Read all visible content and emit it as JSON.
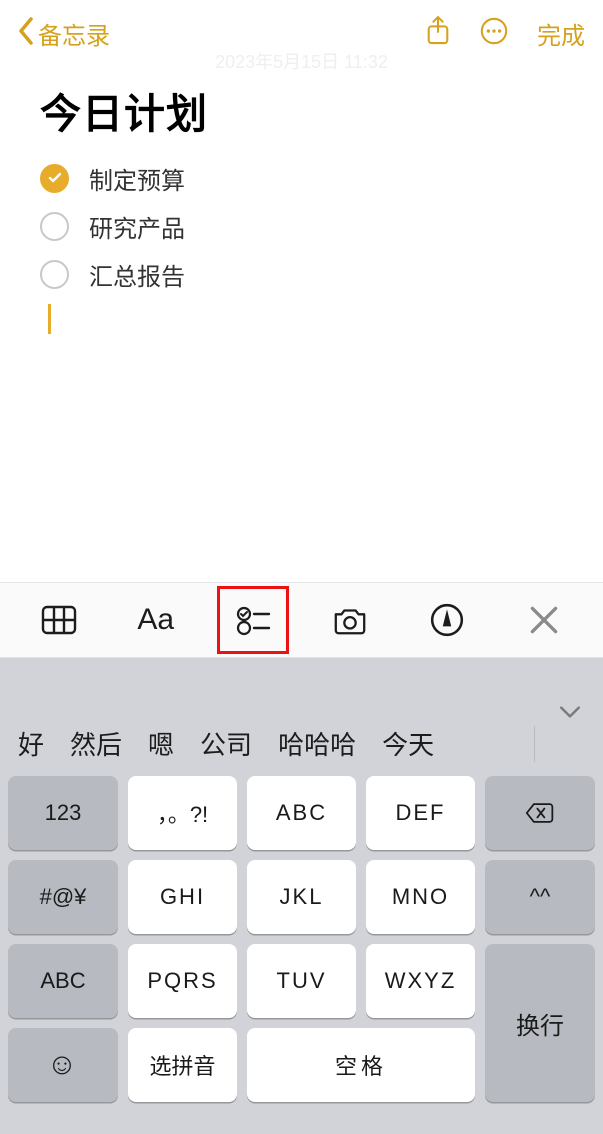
{
  "nav": {
    "back_label": "备忘录",
    "done_label": "完成",
    "timestamp": "2023年5月15日 11:32"
  },
  "note": {
    "title": "今日计划",
    "items": [
      {
        "text": "制定预算",
        "checked": true
      },
      {
        "text": "研究产品",
        "checked": false
      },
      {
        "text": "汇总报告",
        "checked": false
      }
    ]
  },
  "fmtbar": {
    "aa_label": "Aa"
  },
  "suggestions": [
    "好",
    "然后",
    "嗯",
    "公司",
    "哈哈哈",
    "今天"
  ],
  "keyboard": {
    "k_123": "123",
    "k_punct": "，。?!",
    "k_abc": "ABC",
    "k_def": "DEF",
    "k_hash": "#@¥",
    "k_ghi": "GHI",
    "k_jkl": "JKL",
    "k_mno": "MNO",
    "k_faces": "^^",
    "k_abc2": "ABC",
    "k_pqrs": "PQRS",
    "k_tuv": "TUV",
    "k_wxyz": "WXYZ",
    "k_return": "换行",
    "k_select": "选拼音",
    "k_space": "空格"
  }
}
